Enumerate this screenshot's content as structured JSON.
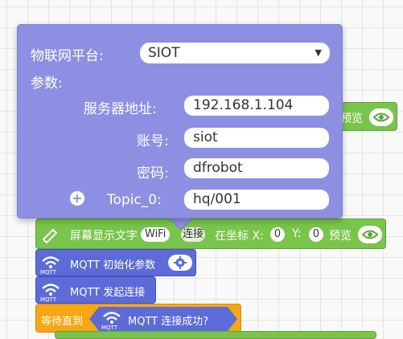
{
  "popup": {
    "platform_label": "物联网平台:",
    "platform_value": "SIOT",
    "params_label": "参数:",
    "server_label": "服务器地址:",
    "server_value": "192.168.1.104",
    "account_label": "账号:",
    "account_value": "siot",
    "password_label": "密码:",
    "password_value": "dfrobot",
    "topic_label": "Topic_0:",
    "topic_value": "hq/001"
  },
  "upper_display_block": {
    "preview_label": "预览"
  },
  "lower_display_block": {
    "text": "屏幕显示文字",
    "text_value": "WiFi",
    "connect_label": "连接",
    "coord_label": "在坐标 X:",
    "x_value": "0",
    "y_label": "Y:",
    "y_value": "0",
    "preview_label": "预览"
  },
  "mqtt_init_block": {
    "label": "MQTT 初始化参数",
    "icon_caption": "MQTT"
  },
  "mqtt_connect_block": {
    "label": "MQTT 发起连接",
    "icon_caption": "MQTT"
  },
  "wait_block": {
    "label": "等待直到",
    "condition_label": "MQTT 连接成功?",
    "icon_caption": "MQTT"
  },
  "colors": {
    "popup_bg": "#8d8fe2",
    "mqtt_block": "#5c6bd8",
    "display_block": "#79c44a",
    "wait_block": "#f7a614"
  }
}
